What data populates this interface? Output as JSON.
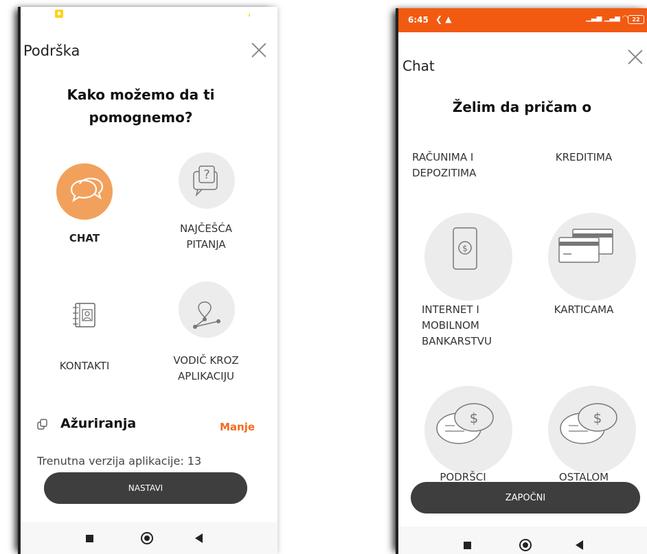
{
  "left": {
    "title": "Podrška",
    "heading": "Kako možemo da ti pomognemo?",
    "options": {
      "chat": "CHAT",
      "faq": "NAJČEŠĆA PITANJA",
      "contacts": "KONTAKTI",
      "guide": "VODIČ KROZ APLIKACIJU"
    },
    "updates": {
      "title": "Ažuriranja",
      "toggle": "Manje",
      "version_text": "Trenutna verzija aplikacije: 13"
    },
    "button": "NASTAVI"
  },
  "right": {
    "status": {
      "time": "6:45",
      "battery": "22"
    },
    "title": "Chat",
    "heading": "Želim da pričam o",
    "topics": {
      "accounts": "RAČUNIMA I DEPOZITIMA",
      "loans": "KREDITIMA",
      "ebanking": "INTERNET I MOBILNOM BANKARSTVU",
      "cards": "KARTICAMA",
      "branches": "PODRŠCI",
      "other": "OSTALOM"
    },
    "button": "ZAPOČNI"
  },
  "colors": {
    "accent": "#f26b1d",
    "status_bar": "#f25a12",
    "chat_circle": "#f2a15c",
    "button": "#3e3e3e"
  },
  "icons": [
    "chat-bubbles-icon",
    "question-bubble-icon",
    "address-book-icon",
    "route-pin-icon",
    "phone-dollar-icon",
    "credit-cards-icon",
    "dollar-bubbles-icon",
    "copy-icon",
    "close-icon"
  ]
}
